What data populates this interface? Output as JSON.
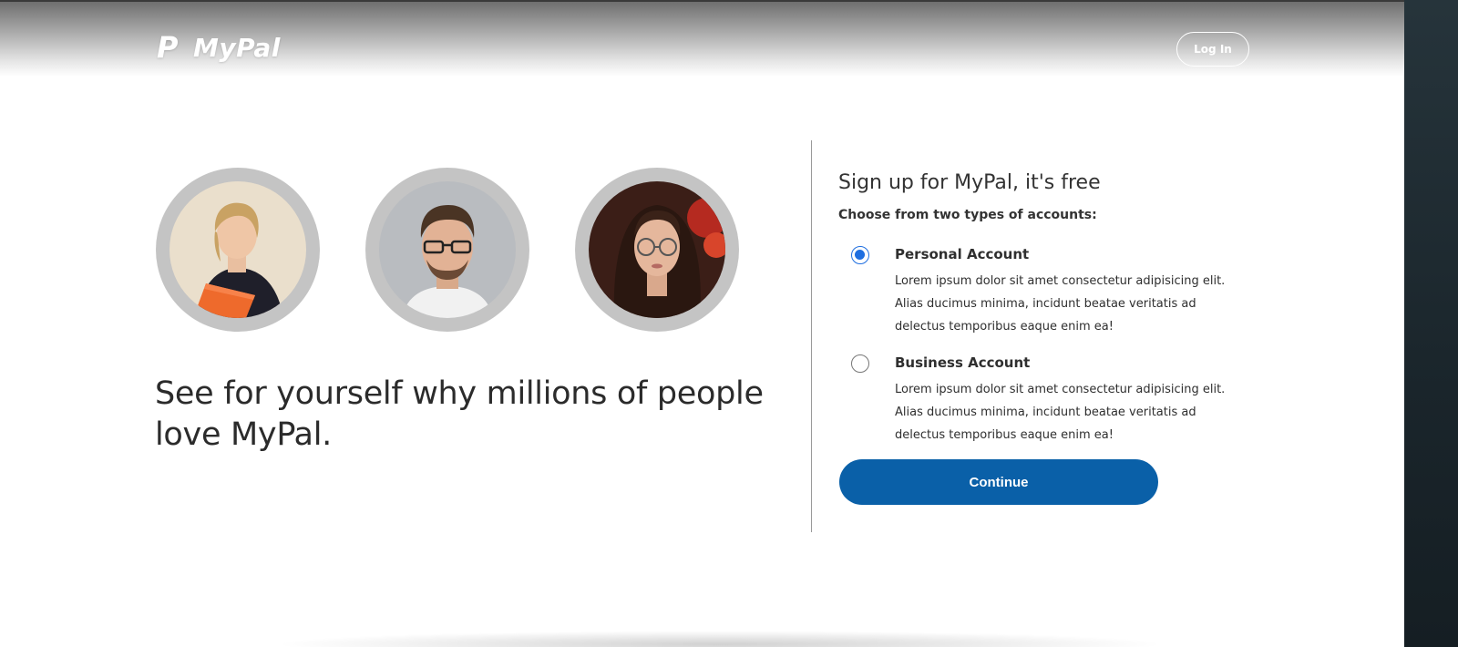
{
  "header": {
    "logo_mark": "P",
    "logo_text": "MyPal",
    "login_label": "Log In"
  },
  "hero": {
    "tagline": "See for yourself why millions of people love MyPal."
  },
  "signup": {
    "title": "Sign up for MyPal, it's free",
    "subtitle": "Choose from two types of accounts:",
    "options": [
      {
        "title": "Personal Account",
        "description": "Lorem ipsum dolor sit amet consectetur adipisicing elit. Alias ducimus minima, incidunt beatae veritatis ad delectus temporibus eaque enim ea!",
        "selected": true
      },
      {
        "title": "Business Account",
        "description": "Lorem ipsum dolor sit amet consectetur adipisicing elit. Alias ducimus minima, incidunt beatae veritatis ad delectus temporibus eaque enim ea!",
        "selected": false
      }
    ],
    "continue_label": "Continue"
  },
  "colors": {
    "primary_button": "#0a60a8",
    "radio_selected": "#1f6fe0",
    "portrait_ring": "#c4c4c4"
  }
}
